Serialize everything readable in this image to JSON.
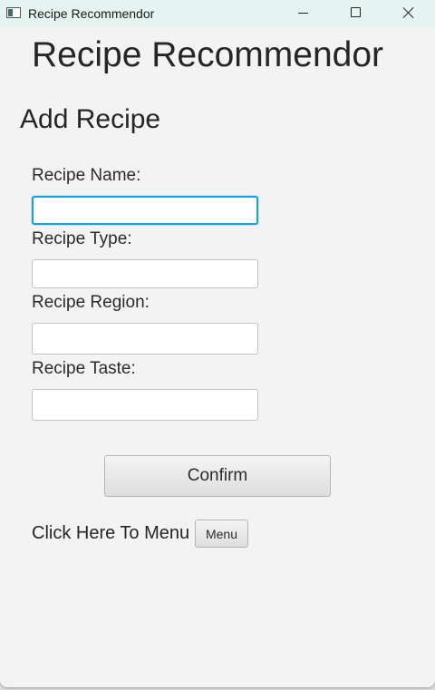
{
  "window": {
    "title": "Recipe Recommendor",
    "app_icon": "app-window-icon",
    "controls": {
      "minimize_icon": "minimize-icon",
      "maximize_icon": "maximize-icon",
      "close_icon": "close-icon"
    }
  },
  "main": {
    "app_heading": "Recipe Recommendor",
    "section_heading": "Add Recipe",
    "fields": [
      {
        "label": "Recipe Name:",
        "value": "",
        "focused": true
      },
      {
        "label": "Recipe Type:",
        "value": ""
      },
      {
        "label": "Recipe Region:",
        "value": ""
      },
      {
        "label": "Recipe Taste:",
        "value": ""
      }
    ],
    "confirm_label": "Confirm",
    "menu_prompt": "Click Here To Menu",
    "menu_label": "Menu"
  },
  "colors": {
    "titlebar_bg": "#e6f4f1",
    "window_bg": "#f3f3f3",
    "focus_accent": "#1f9fd6"
  }
}
